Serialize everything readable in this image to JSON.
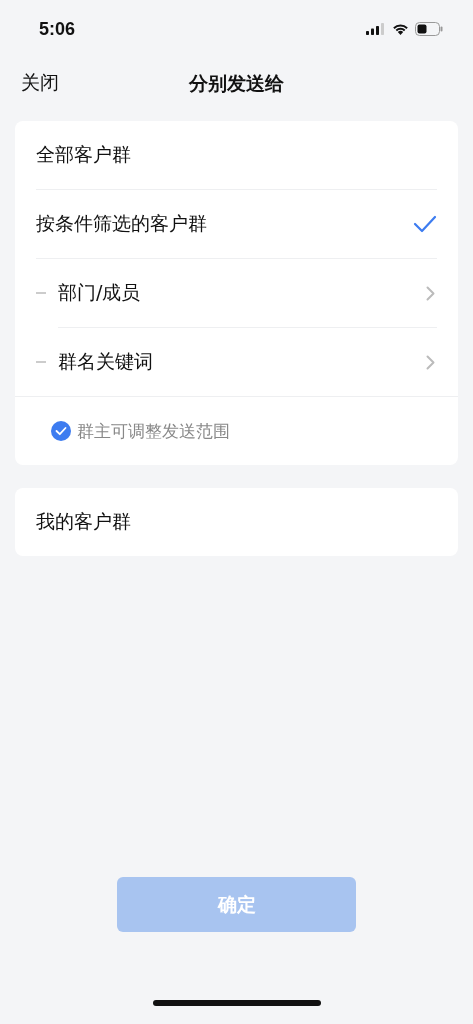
{
  "status_bar": {
    "time": "5:06"
  },
  "nav": {
    "close": "关闭",
    "title": "分别发送给"
  },
  "groups": [
    {
      "options": [
        {
          "label": "全部客户群",
          "selected": false
        },
        {
          "label": "按条件筛选的客户群",
          "selected": true,
          "children": [
            {
              "label": "部门/成员"
            },
            {
              "label": "群名关键词"
            }
          ]
        }
      ],
      "footer": {
        "label": "群主可调整发送范围",
        "checked": true
      }
    },
    {
      "options": [
        {
          "label": "我的客户群",
          "selected": false
        }
      ]
    }
  ],
  "confirm": {
    "label": "确定",
    "disabled": true
  }
}
